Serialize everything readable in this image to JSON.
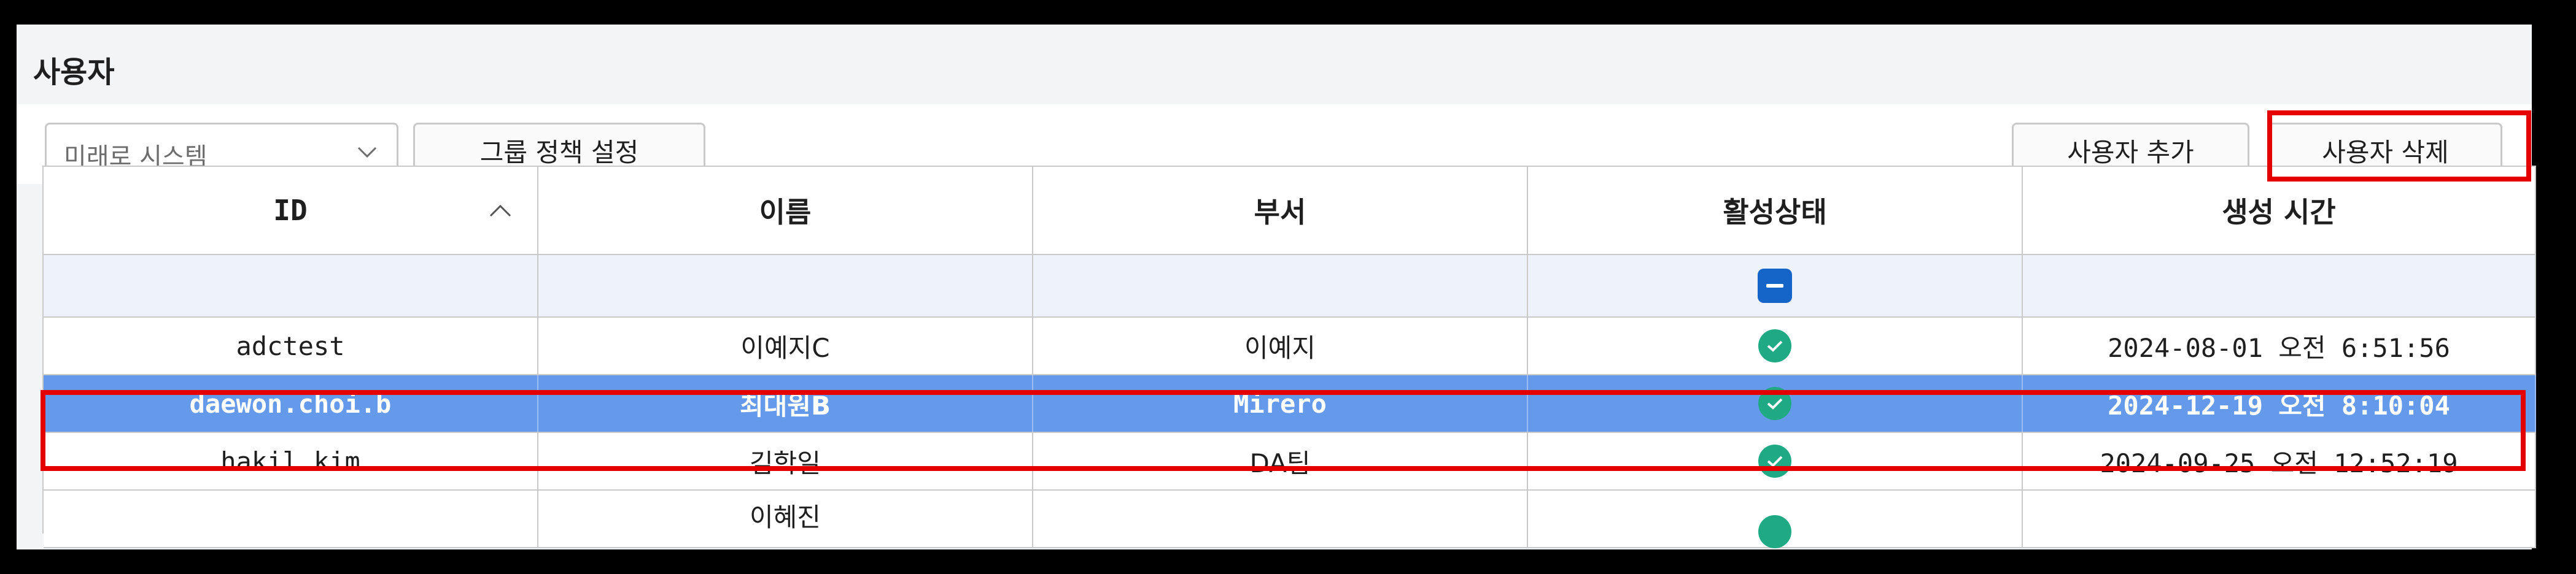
{
  "page": {
    "title": "사용자"
  },
  "toolbar": {
    "group_select": {
      "value": "미래로 시스템",
      "icon": "chevron-down-icon"
    },
    "group_policy_label": "그룹 정책 설정",
    "add_user_label": "사용자 추가",
    "delete_user_label": "사용자 삭제"
  },
  "table": {
    "columns": [
      "ID",
      "이름",
      "부서",
      "활성상태",
      "생성 시간"
    ],
    "sort": {
      "column": "ID",
      "direction": "ascending",
      "icon": "chevron-up-icon"
    },
    "filter": {
      "active_state": "indeterminate"
    },
    "rows": [
      {
        "id": "adctest",
        "name": "이예지C",
        "dept": "이예지",
        "active": true,
        "created": "2024-08-01 오전 6:51:56",
        "selected": false
      },
      {
        "id": "daewon.choi.b",
        "name": "최대원B",
        "dept": "Mirero",
        "active": true,
        "created": "2024-12-19 오전 8:10:04",
        "selected": true
      },
      {
        "id": "hakil.kim",
        "name": "김학일",
        "dept": "DA팀",
        "active": true,
        "created": "2024-09-25 오전 12:52:19",
        "selected": false
      },
      {
        "id": "",
        "name": "이혜진",
        "dept": "",
        "active": true,
        "created": "",
        "selected": false
      }
    ]
  },
  "colors": {
    "selected_row": "#6599ea",
    "active_check": "#1faa84",
    "filter_checkbox": "#1564c8",
    "highlight": "#e50000"
  }
}
